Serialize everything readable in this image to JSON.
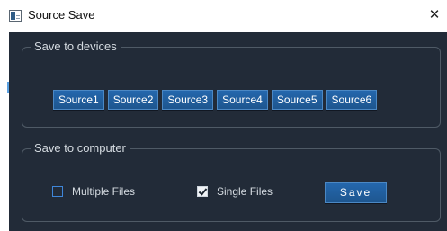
{
  "window": {
    "title": "Source Save",
    "close_glyph": "✕",
    "app_icon": "window-app-icon"
  },
  "devices_group": {
    "label": "Save to devices",
    "buttons": [
      "Source1",
      "Source2",
      "Source3",
      "Source4",
      "Source5",
      "Source6"
    ]
  },
  "computer_group": {
    "label": "Save to computer",
    "multiple_files": {
      "label": "Multiple Files",
      "checked": false
    },
    "single_files": {
      "label": "Single Files",
      "checked": true
    },
    "save_label": "Save"
  },
  "colors": {
    "client_background": "#222b38",
    "button_blue": "#2467ad",
    "button_border": "#4b88c4",
    "group_border": "#4f5a66",
    "text": "#d5dbe1",
    "checkbox_accent": "#3f86d9"
  }
}
